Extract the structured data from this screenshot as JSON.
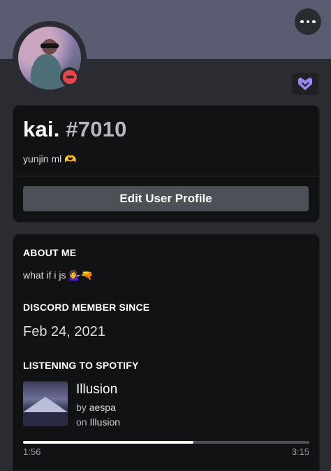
{
  "header": {
    "banner_color": "#5a5d72",
    "more_icon": "ellipsis-icon",
    "status": "do-not-disturb",
    "badge_icon": "hypesquad-icon"
  },
  "profile": {
    "username": "kai.",
    "discriminator": "#7010",
    "custom_status": "yunjin ml 🫶",
    "edit_button_label": "Edit User Profile"
  },
  "about": {
    "title": "ABOUT ME",
    "text": "what if i js 💁‍♀️🔫"
  },
  "member_since": {
    "title": "DISCORD MEMBER SINCE",
    "date": "Feb 24, 2021"
  },
  "spotify": {
    "title": "LISTENING TO SPOTIFY",
    "song": "Illusion",
    "by_prefix": "by",
    "artist": "aespa",
    "on_prefix": "on",
    "album": "Illusion",
    "elapsed": "1:56",
    "duration": "3:15",
    "progress_fraction": 0.595
  }
}
